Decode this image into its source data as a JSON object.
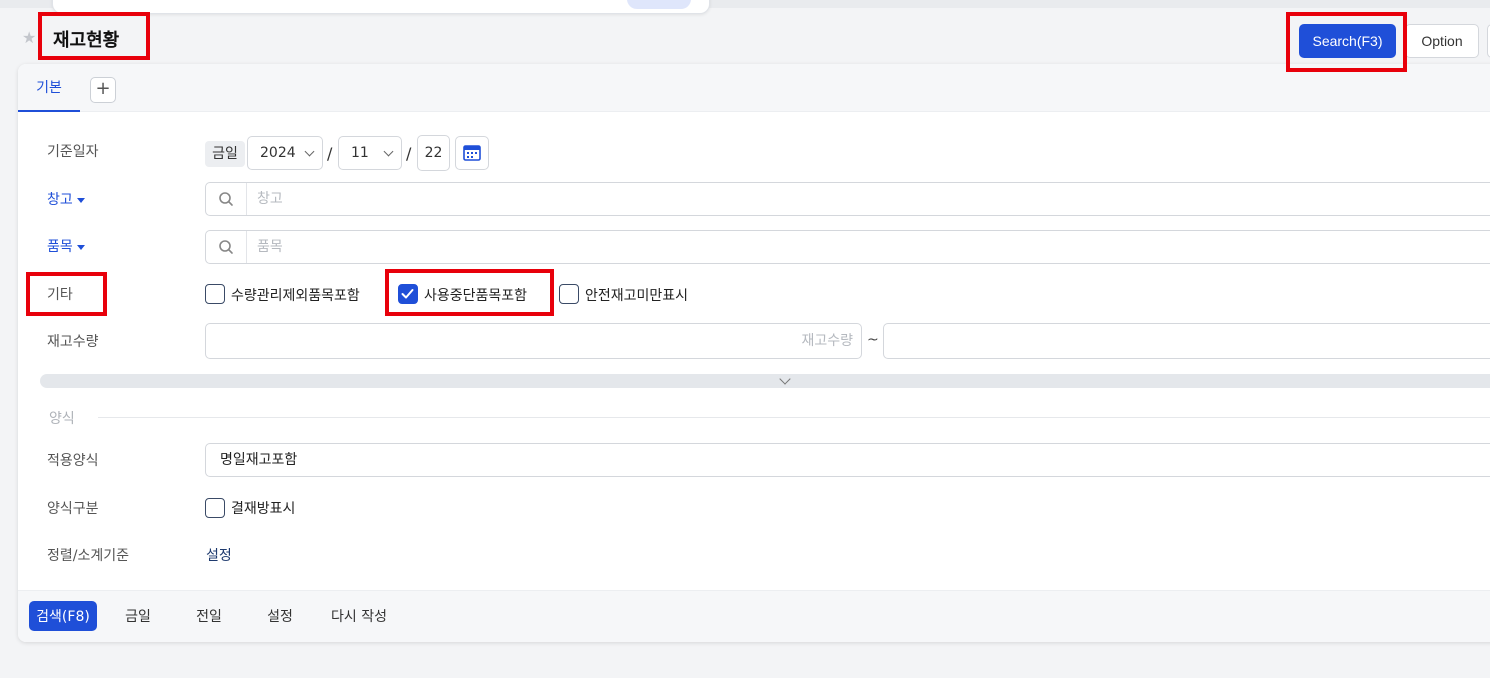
{
  "header": {
    "title": "재고현황",
    "search_button": "Search(F3)",
    "option_button": "Option"
  },
  "tabs": [
    {
      "label": "기본"
    }
  ],
  "add_tab_icon": "plus-icon",
  "form": {
    "base_date": {
      "label": "기준일자",
      "today_chip": "금일",
      "year": "2024",
      "month": "11",
      "day": "22",
      "separator": "/"
    },
    "warehouse": {
      "label": "창고",
      "placeholder": "창고"
    },
    "item": {
      "label": "품목",
      "placeholder": "품목"
    },
    "etc": {
      "label": "기타",
      "options": [
        {
          "label": "수량관리제외품목포함",
          "checked": false
        },
        {
          "label": "사용중단품목포함",
          "checked": true
        },
        {
          "label": "안전재고미만표시",
          "checked": false
        }
      ]
    },
    "stock_qty": {
      "label": "재고수량",
      "placeholder": "재고수량",
      "tilde": "~"
    }
  },
  "format_section": {
    "title": "양식",
    "applied_format": {
      "label": "적용양식",
      "value": "명일재고포함"
    },
    "format_type": {
      "label": "양식구분",
      "option": "결재방표시",
      "checked": false
    },
    "sort": {
      "label": "정렬/소계기준",
      "link": "설정"
    }
  },
  "bottom": {
    "search": "검색(F8)",
    "today": "금일",
    "prev_day": "전일",
    "settings": "설정",
    "rewrite": "다시 작성"
  },
  "colors": {
    "primary": "#1f4fd8",
    "annotation_red": "#e8000b",
    "label_gray": "#555555"
  }
}
